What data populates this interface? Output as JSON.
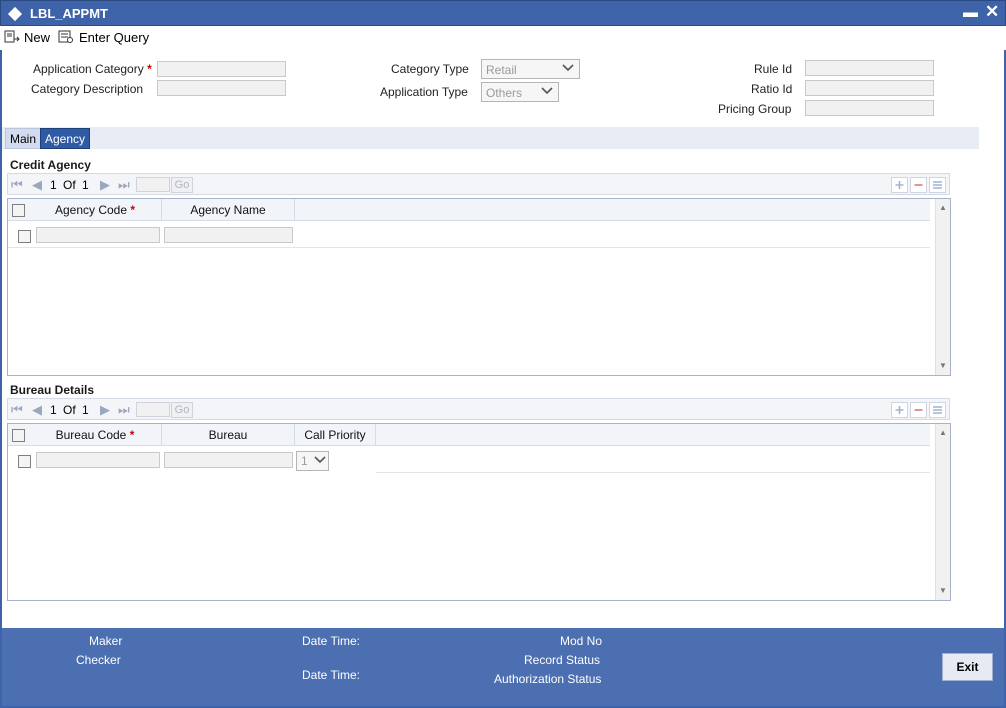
{
  "window": {
    "title": "LBL_APPMT",
    "minimize": "▬",
    "close": "✕"
  },
  "toolbar": {
    "new_label": "New",
    "enter_query_label": "Enter Query"
  },
  "header": {
    "application_category_label": "Application Category",
    "category_description_label": "Category Description",
    "category_type_label": "Category Type",
    "category_type_value": "Retail",
    "application_type_label": "Application Type",
    "application_type_value": "Others",
    "rule_id_label": "Rule Id",
    "ratio_id_label": "Ratio Id",
    "pricing_group_label": "Pricing Group",
    "required_mark": "*"
  },
  "tabs": [
    {
      "label": "Main",
      "active": false
    },
    {
      "label": "Agency",
      "active": true
    }
  ],
  "credit_agency": {
    "title": "Credit Agency",
    "pager": {
      "current": "1",
      "of": "Of",
      "total": "1",
      "go": "Go"
    },
    "columns": [
      "Agency Code",
      "Agency Name"
    ]
  },
  "bureau_details": {
    "title": "Bureau Details",
    "pager": {
      "current": "1",
      "of": "Of",
      "total": "1",
      "go": "Go"
    },
    "columns": [
      "Bureau Code",
      "Bureau",
      "Call Priority"
    ],
    "call_priority_value": "1"
  },
  "footer": {
    "maker_label": "Maker",
    "checker_label": "Checker",
    "date_time_label_1": "Date Time:",
    "date_time_label_2": "Date Time:",
    "mod_no_label": "Mod No",
    "record_status_label": "Record Status",
    "authorization_status_label": "Authorization Status",
    "exit_label": "Exit"
  },
  "colors": {
    "titlebar": "#3e63a8",
    "footer": "#4b6fb0",
    "tab_active": "#2f5ba4",
    "required": "#cc0000"
  }
}
